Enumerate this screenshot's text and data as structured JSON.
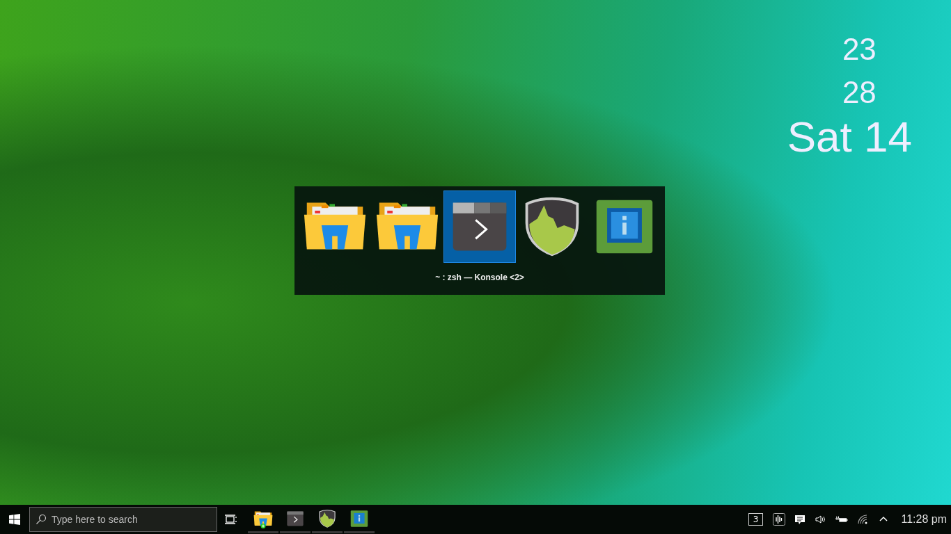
{
  "desktop_widget": {
    "hour": "23",
    "minute": "28",
    "date": "Sat 14"
  },
  "switcher": {
    "items": [
      {
        "kind": "folder",
        "selected": false
      },
      {
        "kind": "folder",
        "selected": false
      },
      {
        "kind": "terminal",
        "selected": true
      },
      {
        "kind": "monitor",
        "selected": false
      },
      {
        "kind": "info",
        "selected": false
      }
    ],
    "caption": "~ : zsh — Konsole <2>"
  },
  "taskbar": {
    "search": {
      "placeholder": "Type here to search"
    },
    "apps": [
      {
        "kind": "folder"
      },
      {
        "kind": "terminal"
      },
      {
        "kind": "monitor"
      },
      {
        "kind": "info"
      }
    ],
    "tray": {
      "desktop_number": "3",
      "time": "11:28 pm"
    }
  }
}
